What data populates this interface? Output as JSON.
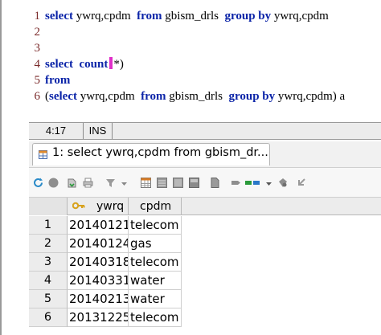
{
  "editor": {
    "lines": [
      {
        "no": "1",
        "parts": [
          {
            "t": "select",
            "k": true
          },
          {
            "t": " ywrq,cpdm  "
          },
          {
            "t": "from",
            "k": true
          },
          {
            "t": " gbism_drls  "
          },
          {
            "t": "group by",
            "k": true
          },
          {
            "t": " ywrq,cpdm"
          }
        ]
      },
      {
        "no": "2",
        "parts": []
      },
      {
        "no": "3",
        "parts": []
      },
      {
        "no": "4",
        "parts": [
          {
            "t": "select",
            "k": true
          },
          {
            "t": "  "
          },
          {
            "t": "count",
            "k": true
          },
          {
            "t": "*)",
            "cursor_before": true
          }
        ]
      },
      {
        "no": "5",
        "parts": [
          {
            "t": "from",
            "k": true
          }
        ]
      },
      {
        "no": "6",
        "parts": [
          {
            "t": "("
          },
          {
            "t": "select",
            "k": true
          },
          {
            "t": " ywrq,cpdm  "
          },
          {
            "t": "from",
            "k": true
          },
          {
            "t": " gbism_drls  "
          },
          {
            "t": "group by",
            "k": true
          },
          {
            "t": " ywrq,cpdm) a"
          }
        ]
      }
    ]
  },
  "status": {
    "position": "4:17",
    "mode": "INS"
  },
  "result_tab": {
    "label": "1: select ywrq,cpdm from gbism_dr..."
  },
  "grid": {
    "columns": [
      "ywrq",
      "cpdm"
    ],
    "rows": [
      {
        "n": "1",
        "ywrq": "20140121",
        "cpdm": "telecom"
      },
      {
        "n": "2",
        "ywrq": "20140124",
        "cpdm": "gas"
      },
      {
        "n": "3",
        "ywrq": "20140318",
        "cpdm": "telecom"
      },
      {
        "n": "4",
        "ywrq": "20140331",
        "cpdm": "water"
      },
      {
        "n": "5",
        "ywrq": "20140213",
        "cpdm": "water"
      },
      {
        "n": "6",
        "ywrq": "20131225",
        "cpdm": "telecom"
      }
    ]
  },
  "colors": {
    "keyword": "#0b24a8",
    "line_number": "#7a2a2a",
    "cursor": "#e02ec8"
  },
  "toolbar_icons": [
    "refresh-icon",
    "stop-icon",
    "fetch-next-icon",
    "print-icon",
    "filter-icon",
    "dropdown-arrow-icon",
    "grid-view-icon",
    "record-view-icon",
    "text-view-icon",
    "export-icon",
    "mark-icon",
    "transfer-icon",
    "dropdown-arrow-icon",
    "save-icon",
    "undo-icon"
  ]
}
